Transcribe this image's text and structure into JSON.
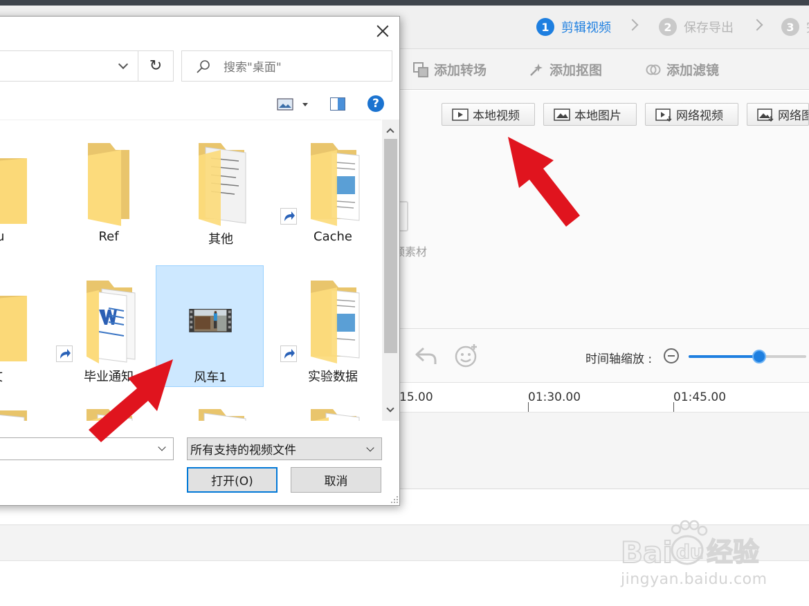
{
  "steps": [
    {
      "num": "1",
      "label": "剪辑视频",
      "active": true
    },
    {
      "num": "2",
      "label": "保存导出",
      "active": false
    },
    {
      "num": "3",
      "label": "完",
      "active": false
    }
  ],
  "tool_tabs": [
    {
      "label": "添加转场",
      "icon": "transition-icon"
    },
    {
      "label": "添加抠图",
      "icon": "cutout-icon"
    },
    {
      "label": "添加滤镜",
      "icon": "filter-icon"
    }
  ],
  "import_buttons": [
    {
      "label": "本地视频",
      "icon": "video-file-icon"
    },
    {
      "label": "本地图片",
      "icon": "image-file-icon"
    },
    {
      "label": "网络视频",
      "icon": "web-video-icon"
    },
    {
      "label": "网络图",
      "icon": "web-image-icon"
    }
  ],
  "drop_hint": "频素材",
  "timeline": {
    "zoom_label": "时间轴缩放 :",
    "zoom_level": 0.6,
    "ticks": [
      "15.00",
      "01:30.00",
      "01:45.00"
    ]
  },
  "dialog": {
    "search_placeholder": "搜索\"桌面\"",
    "refresh_glyph": "↻",
    "help_glyph": "?",
    "files": [
      {
        "name": "du",
        "kind": "folder",
        "shortcut": false
      },
      {
        "name": "Ref",
        "kind": "folder",
        "shortcut": false
      },
      {
        "name": "其他",
        "kind": "folder-docs",
        "shortcut": false
      },
      {
        "name": "Cache",
        "kind": "folder-docs",
        "shortcut": true
      },
      {
        "name": "文",
        "kind": "folder",
        "shortcut": false
      },
      {
        "name": "毕业通知",
        "kind": "folder-word",
        "shortcut": true
      },
      {
        "name": "风车1",
        "kind": "video",
        "shortcut": false,
        "selected": true
      },
      {
        "name": "实验数据",
        "kind": "folder-docs",
        "shortcut": true
      }
    ],
    "file_filter": "所有支持的视频文件",
    "open_label": "打开(O)",
    "cancel_label": "取消"
  },
  "watermark": {
    "brand": "Baidu经验",
    "url": "jingyan.baidu.com"
  },
  "colors": {
    "accent": "#1e7fe0",
    "arrow": "#e0141e",
    "selection": "#cde8ff"
  }
}
